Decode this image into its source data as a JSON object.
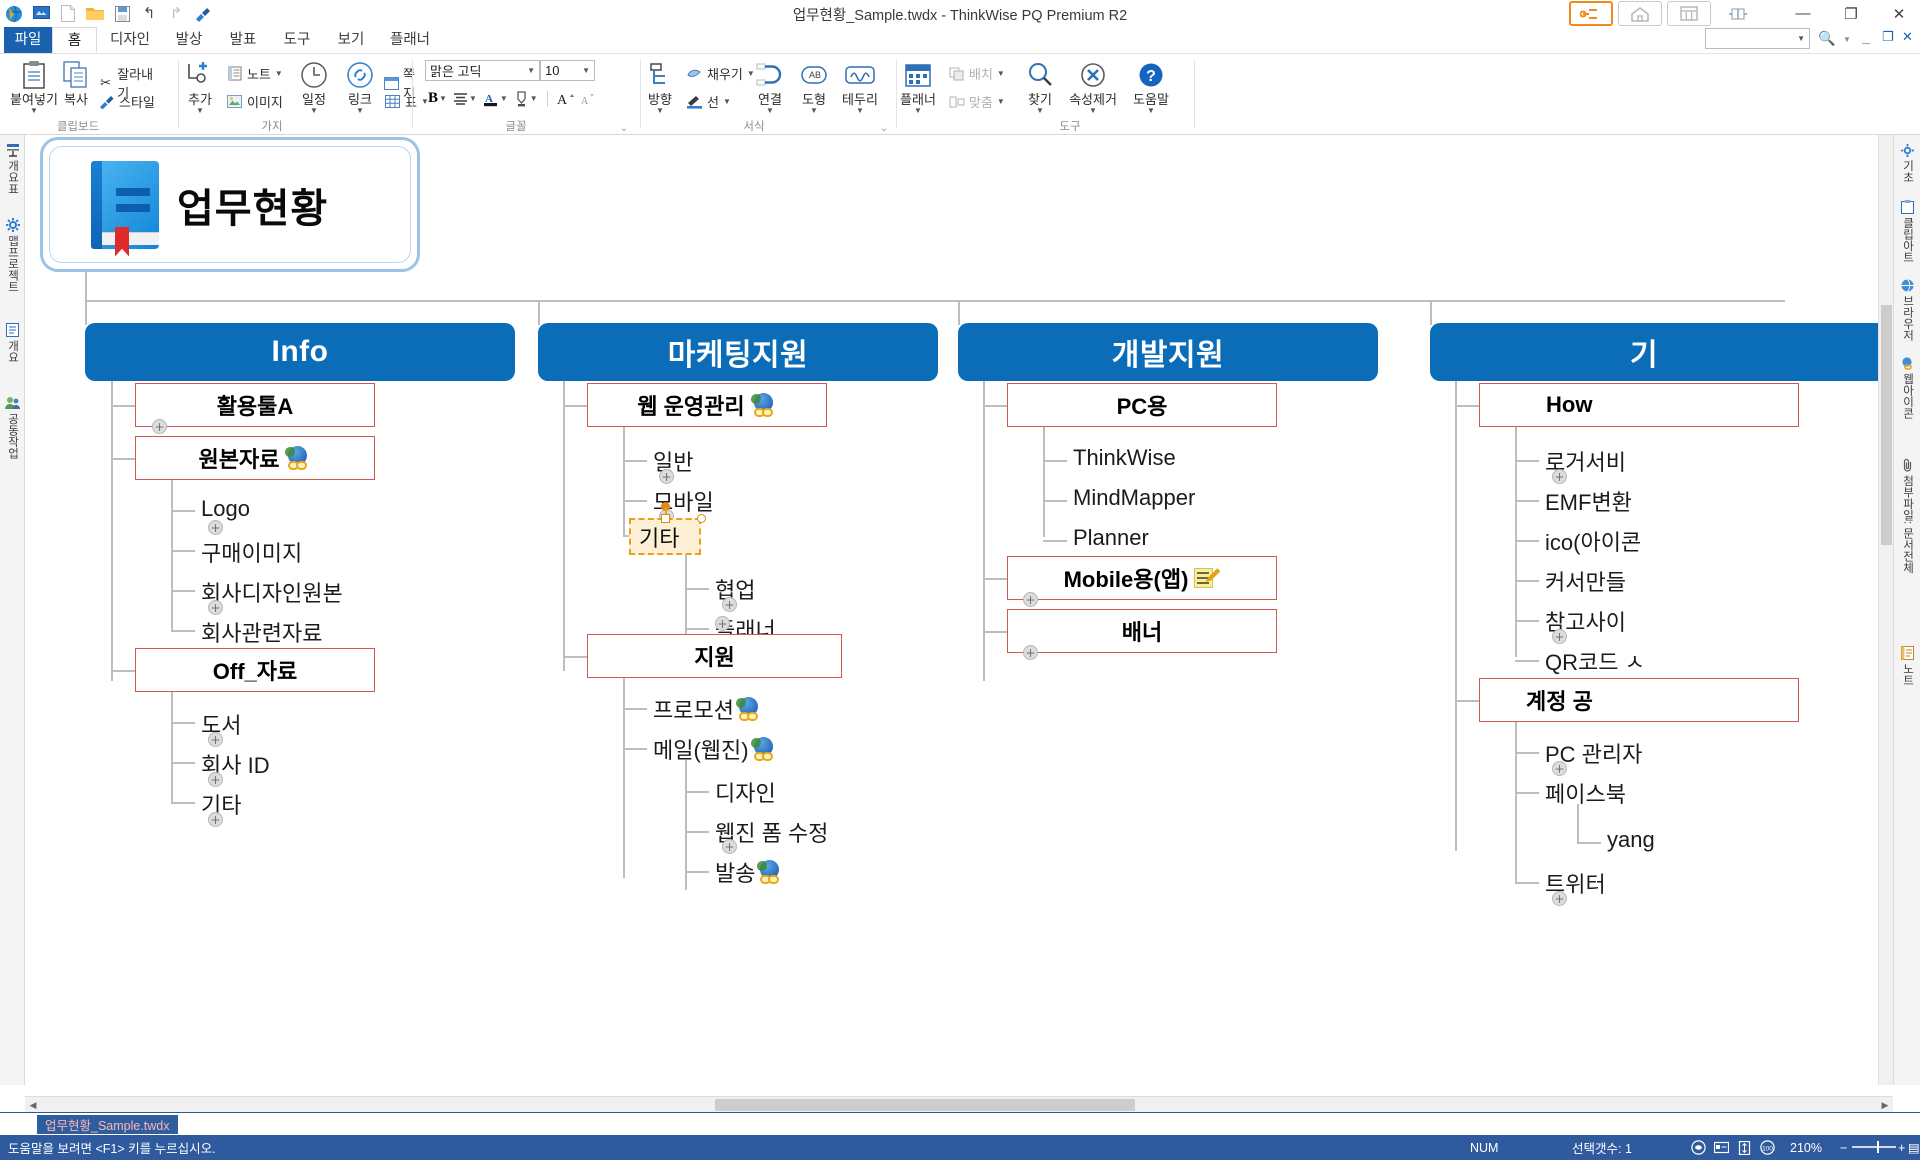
{
  "window": {
    "title": "업무현황_Sample.twdx - ThinkWise PQ Premium R2",
    "minimize": "—",
    "maximize": "❐",
    "close": "✕"
  },
  "quick_access": [
    "thinkwise-logo-icon",
    "present-icon",
    "new-doc-icon",
    "open-folder-icon",
    "save-icon",
    "undo-icon",
    "redo-icon",
    "format-painter-icon"
  ],
  "menu_tabs": [
    {
      "label": "파일",
      "state": "file"
    },
    {
      "label": "홈",
      "state": "active"
    },
    {
      "label": "디자인",
      "state": "normal"
    },
    {
      "label": "발상",
      "state": "normal"
    },
    {
      "label": "발표",
      "state": "normal"
    },
    {
      "label": "도구",
      "state": "normal"
    },
    {
      "label": "보기",
      "state": "normal"
    },
    {
      "label": "플래너",
      "state": "normal"
    }
  ],
  "ribbon": {
    "groups": [
      {
        "name": "클립보드",
        "big": [
          {
            "label": "붙여넣기",
            "icon": "clipboard-paste-icon",
            "caret": true
          }
        ],
        "small": [
          {
            "label": "복사",
            "icon": "copy-icon"
          },
          {
            "label": "잘라내기",
            "icon": "scissors-icon"
          },
          {
            "label": "스타일",
            "icon": "brush-icon"
          }
        ]
      },
      {
        "name": "가지",
        "big": [
          {
            "label": "추가",
            "icon": "add-branch-icon",
            "caret": true
          },
          {
            "label": "일정",
            "icon": "clock-icon",
            "caret": true
          },
          {
            "label": "링크",
            "icon": "link-icon",
            "caret": true
          }
        ],
        "small": [
          {
            "label": "노트",
            "icon": "note-icon",
            "caret": true
          },
          {
            "label": "이미지",
            "icon": "image-icon"
          },
          {
            "label": "쪽지",
            "icon": "memo-icon"
          },
          {
            "label": "표",
            "icon": "table-icon",
            "caret": true
          }
        ]
      },
      {
        "name": "글꼴",
        "font_name": "맑은 고딕",
        "font_size": "10",
        "tools": [
          "B",
          "align-icon",
          "font-color-icon",
          "highlight-icon",
          "grow-font-icon",
          "shrink-font-icon"
        ]
      },
      {
        "name": "서식",
        "big": [
          {
            "label": "방향",
            "icon": "direction-icon",
            "caret": true
          },
          {
            "label": "연결",
            "icon": "connector-icon",
            "caret": true
          },
          {
            "label": "도형",
            "icon": "shape-icon",
            "caret": true
          },
          {
            "label": "테두리",
            "icon": "border-icon",
            "caret": true
          }
        ],
        "small": [
          {
            "label": "채우기",
            "icon": "fill-icon",
            "caret": true
          },
          {
            "label": "선",
            "icon": "line-icon",
            "caret": true
          }
        ]
      },
      {
        "name": "도구",
        "big": [
          {
            "label": "플래너",
            "icon": "calendar-icon",
            "caret": true
          },
          {
            "label": "찾기",
            "icon": "search-icon",
            "caret": true
          },
          {
            "label": "속성제거",
            "icon": "clear-format-icon",
            "caret": true
          },
          {
            "label": "도움말",
            "icon": "help-icon",
            "caret": true
          }
        ],
        "small": [
          {
            "label": "배치",
            "icon": "arrange-icon",
            "caret": true
          },
          {
            "label": "맞춤",
            "icon": "align-objects-icon",
            "caret": true
          }
        ]
      }
    ],
    "view_buttons": [
      "outline-view-icon",
      "home-view-icon",
      "grid-view-icon",
      "split-view-icon"
    ],
    "search_placeholder": ""
  },
  "left_panel_tabs": [
    {
      "icon": "outline-icon",
      "label": "개요표"
    },
    {
      "icon": "gear-icon",
      "label": "맵프로젝트"
    },
    {
      "icon": "doc-icon",
      "label": "개요"
    },
    {
      "icon": "people-icon",
      "label": "공동작업"
    }
  ],
  "right_panel_tabs": [
    {
      "icon": "gear-icon",
      "label": "기초"
    },
    {
      "icon": "clipboard-icon",
      "label": "클립아트"
    },
    {
      "icon": "globe-icon",
      "label": "브라우저"
    },
    {
      "icon": "link-icon",
      "label": "웹아이콘"
    },
    {
      "icon": "clip-icon",
      "label": "첨부파일: 문서전체"
    },
    {
      "icon": "note-icon",
      "label": "노트"
    }
  ],
  "mindmap": {
    "root": {
      "label": "업무현황",
      "icon": "blue-book-icon"
    },
    "branches": [
      {
        "label": "Info",
        "children": [
          {
            "label": "활용툴A",
            "type": "box",
            "icon": null,
            "children": []
          },
          {
            "label": "원본자료",
            "type": "box",
            "icon": "globe-link-icon",
            "children": [
              {
                "label": "Logo"
              },
              {
                "label": "구매이미지"
              },
              {
                "label": "회사디자인원본"
              },
              {
                "label": "회사관련자료"
              }
            ]
          },
          {
            "label": "Off_자료",
            "type": "box",
            "icon": null,
            "children": [
              {
                "label": "도서"
              },
              {
                "label": "회사 ID"
              },
              {
                "label": "기타"
              }
            ]
          }
        ]
      },
      {
        "label": "마케팅지원",
        "children": [
          {
            "label": "웹 운영관리",
            "type": "box",
            "icon": "globe-link-icon",
            "children": [
              {
                "label": "일반"
              },
              {
                "label": "모바일"
              },
              {
                "label": "기타",
                "selected": true,
                "children": [
                  {
                    "label": "협업"
                  },
                  {
                    "label": "플래너"
                  }
                ]
              }
            ]
          },
          {
            "label": "지원",
            "type": "box",
            "icon": null,
            "children": [
              {
                "label": "프로모션",
                "icon": "globe-link-icon"
              },
              {
                "label": "메일(웹진)",
                "icon": "globe-link-icon",
                "children": [
                  {
                    "label": "디자인"
                  },
                  {
                    "label": "웹진 폼 수정"
                  },
                  {
                    "label": "발송",
                    "icon": "globe-link-icon"
                  }
                ]
              }
            ]
          }
        ]
      },
      {
        "label": "개발지원",
        "children": [
          {
            "label": "PC용",
            "type": "box",
            "icon": null,
            "children": [
              {
                "label": "ThinkWise"
              },
              {
                "label": "MindMapper"
              },
              {
                "label": "Planner"
              }
            ]
          },
          {
            "label": "Mobile용(앱)",
            "type": "box",
            "icon": "note-pencil-icon",
            "children": []
          },
          {
            "label": "배너",
            "type": "box",
            "icon": null,
            "children": []
          }
        ]
      },
      {
        "label": "기",
        "clipped": true,
        "children": [
          {
            "label": "How",
            "type": "box",
            "icon": null,
            "children": [
              {
                "label": "로거서비"
              },
              {
                "label": "EMF변환"
              },
              {
                "label": "ico(아이콘"
              },
              {
                "label": "커서만들"
              },
              {
                "label": "참고사이"
              },
              {
                "label": "QR코드 ㅅ"
              }
            ]
          },
          {
            "label": "계정 공",
            "type": "box",
            "icon": null,
            "children": [
              {
                "label": "PC 관리자"
              },
              {
                "label": "페이스북",
                "children": [
                  {
                    "label": "yang"
                  }
                ]
              },
              {
                "label": "트위터"
              }
            ]
          }
        ]
      }
    ]
  },
  "doc_tab": {
    "label": "업무현황_Sample.twdx"
  },
  "status": {
    "hint": "도움말을 보려면 <F1> 키를 누르십시오.",
    "num": "NUM",
    "selection": "선택갯수: 1",
    "zoom": "210%",
    "view_icons": [
      "zoom-icon",
      "fit-width-icon",
      "fit-page-icon",
      "zoom-100-icon"
    ],
    "zoom_out": "−",
    "zoom_in": "+"
  },
  "colors": {
    "accent_blue": "#0b6cb8",
    "ribbon_file": "#1a62b0",
    "node_border_red": "#d05a52",
    "selection_orange": "#e8a020",
    "status_blue": "#2f5b9e"
  }
}
